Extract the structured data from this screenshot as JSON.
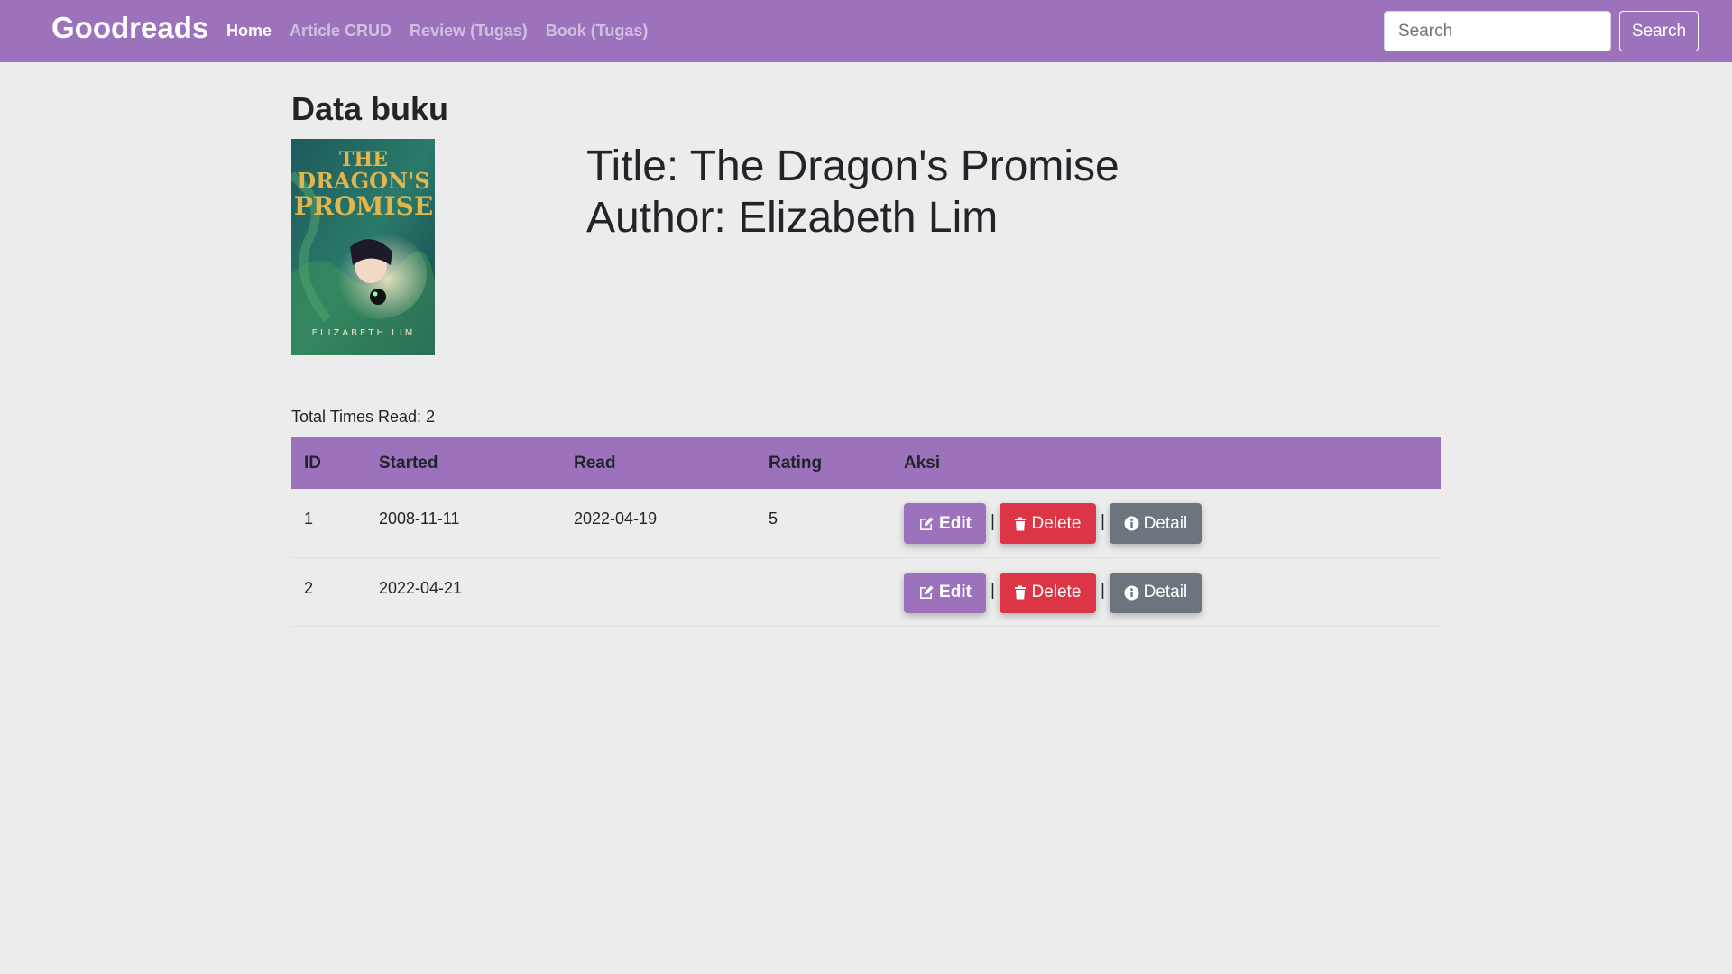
{
  "navbar": {
    "brand": "Goodreads",
    "links": [
      {
        "label": "Home",
        "active": true
      },
      {
        "label": "Article CRUD",
        "active": false
      },
      {
        "label": "Review (Tugas)",
        "active": false
      },
      {
        "label": "Book (Tugas)",
        "active": false
      }
    ],
    "search_placeholder": "Search",
    "search_button": "Search",
    "bg_color": "#9b72bb"
  },
  "main": {
    "page_title": "Data buku",
    "cover_image": {
      "title_line1": "THE",
      "title_line2": "DRAGON'S",
      "title_line3": "PROMISE",
      "author": "ELIZABETH LIM"
    },
    "book": {
      "title_label": "Title",
      "title_value": "The Dragon's Promise",
      "author_label": "Author",
      "author_value": "Elizabeth Lim"
    },
    "total_times_read": "Total Times Read: 2",
    "table": {
      "headers": [
        "ID",
        "Started",
        "Read",
        "Rating",
        "Aksi"
      ],
      "rows": [
        {
          "id": "1",
          "started": "2008-11-11",
          "read": "2022-04-19",
          "rating": "5"
        },
        {
          "id": "2",
          "started": "2022-04-21",
          "read": "",
          "rating": ""
        }
      ],
      "actions": {
        "edit": "Edit",
        "delete": "Delete",
        "detail": "Detail",
        "separator": "|"
      }
    }
  },
  "colors": {
    "accent": "#9b72bb",
    "danger": "#dc3545",
    "secondary": "#6c757d",
    "background": "#ececec"
  }
}
